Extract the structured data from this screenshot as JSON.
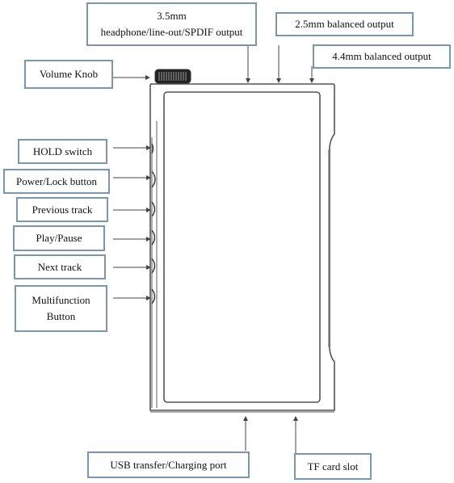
{
  "labels": {
    "headphone_out": [
      "3.5mm",
      "headphone/line-out/SPDIF output"
    ],
    "balanced_25": "2.5mm balanced output",
    "balanced_44": "4.4mm balanced output",
    "volume_knob": "Volume Knob",
    "hold_switch": "HOLD switch",
    "power_lock": "Power/Lock button",
    "previous_track": "Previous track",
    "play_pause": "Play/Pause",
    "next_track": "Next track",
    "multifunction": [
      "Multifunction",
      "Button"
    ],
    "usb_port": "USB transfer/Charging port",
    "tf_slot": "TF card slot"
  },
  "colors": {
    "label_border": "#7b95ad",
    "device_outline": "#555555",
    "leader_line": "#444444"
  }
}
